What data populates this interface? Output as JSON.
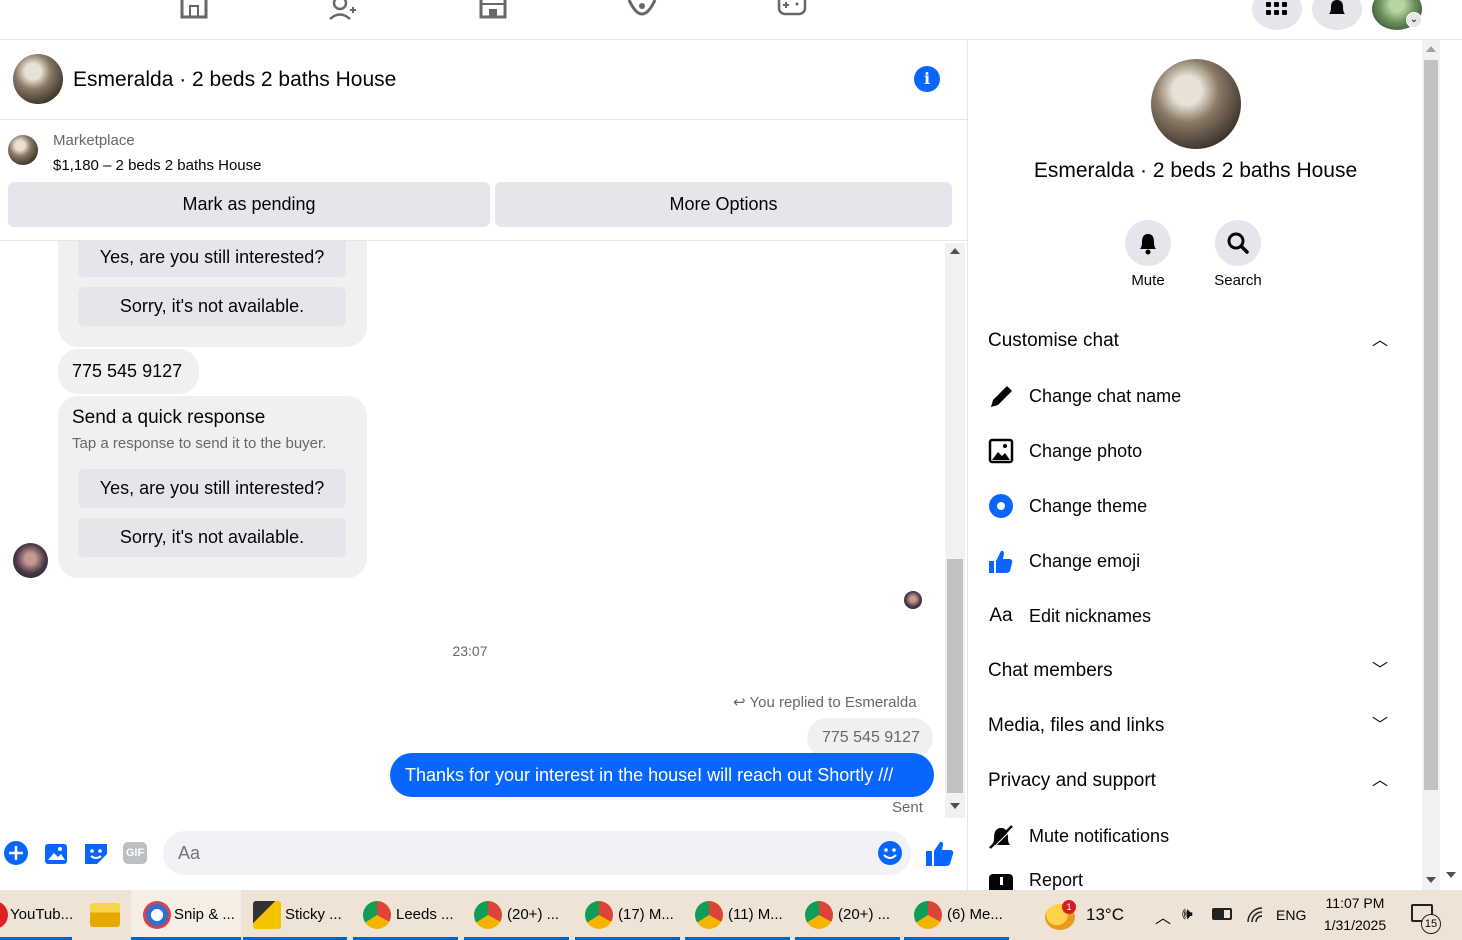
{
  "chat": {
    "title": "Esmeralda · 2 beds 2 baths House",
    "marketplace_label": "Marketplace",
    "listing": "$1,180 – 2 beds 2 baths House",
    "mark_pending": "Mark as pending",
    "more_options": "More Options"
  },
  "messages": {
    "qr_yes_1": "Yes, are you still interested?",
    "qr_no_1": "Sorry, it's not available.",
    "phone_1": "775 545 9127",
    "quick_title": "Send a quick response",
    "quick_sub": "Tap a response to send it to the buyer.",
    "qr_yes_2": "Yes, are you still interested?",
    "qr_no_2": "Sorry, it's not available.",
    "time": "23:07",
    "replied_to": "You replied to Esmeralda",
    "quoted_phone": "775 545 9127",
    "sent_text": "Thanks for your interest in the houseI will reach out Shortly ///",
    "sent_status": "Sent"
  },
  "composer": {
    "placeholder": "Aa",
    "gif_label": "GIF"
  },
  "panel": {
    "title": "Esmeralda · 2 beds 2 baths House",
    "mute": "Mute",
    "search": "Search",
    "customise": "Customise chat",
    "change_name": "Change chat name",
    "change_photo": "Change photo",
    "change_theme": "Change theme",
    "change_emoji": "Change emoji",
    "edit_nicknames": "Edit nicknames",
    "nick_icon_text": "Aa",
    "chat_members": "Chat members",
    "media": "Media, files and links",
    "privacy": "Privacy and support",
    "mute_notifications": "Mute notifications",
    "report": "Report"
  },
  "taskbar": {
    "items": [
      "YouTub...",
      "Snip & ...",
      "Sticky ...",
      "Leeds ...",
      "(20+) ...",
      "(17) M...",
      "(11) M...",
      "(20+) ...",
      "(6) Me..."
    ],
    "weather": "13°C",
    "weather_badge": "1",
    "lang": "ENG",
    "time": "11:07 PM",
    "date": "1/31/2025",
    "notif_count": "15"
  },
  "colors": {
    "accent": "#0866ff",
    "bubble": "#f0f0f0",
    "taskbar": "#eee3d4"
  }
}
